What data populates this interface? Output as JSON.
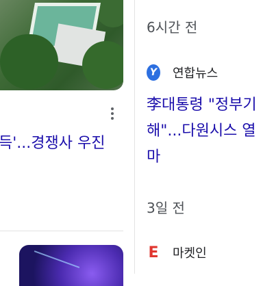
{
  "left_card": {
    "headline_fragment": "득'...경쟁사 우진",
    "thumbnail_icon": "aerial-pool-photo"
  },
  "right_card_1": {
    "time": "6시간 전",
    "source_logo_letter": "Y",
    "source_name": "연합뉴스",
    "headline_lines": [
      "李대통령 \"정부기",
      "해\"...다원시스 열",
      "마"
    ]
  },
  "right_card_2": {
    "time": "3일 전",
    "source_logo_letter": "E",
    "source_name": "마켓인"
  },
  "colors": {
    "headline": "#1a0dab",
    "meta_text": "#4d5156",
    "divider": "#e3e3e3",
    "yonhap_logo": "#2c6fe0",
    "marketin_logo": "#e0362f"
  }
}
